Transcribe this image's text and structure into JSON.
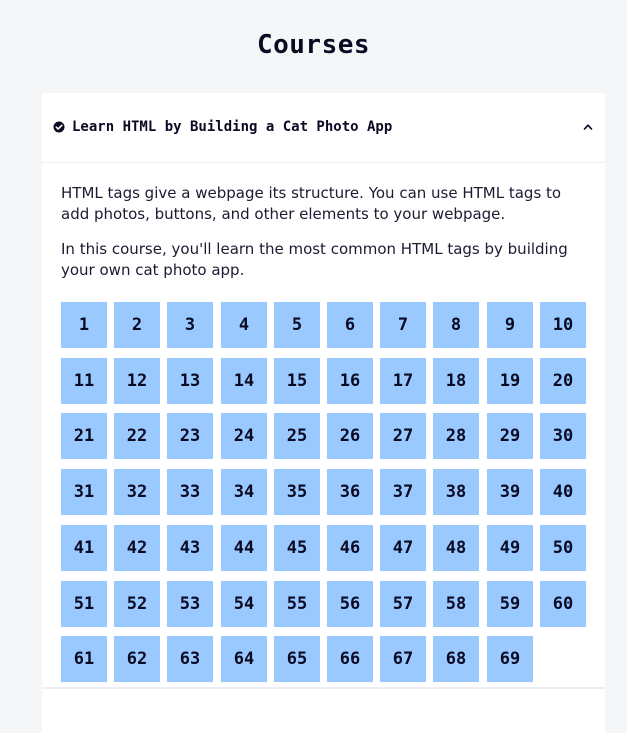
{
  "page_title": "Courses",
  "course": {
    "title": "Learn HTML by Building a Cat Photo App",
    "status_icon": "check-circle-icon",
    "toggle_icon": "chevron-up-icon",
    "description": [
      "HTML tags give a webpage its structure. You can use HTML tags to add photos, buttons, and other elements to your webpage.",
      "In this course, you'll learn the most common HTML tags by building your own cat photo app."
    ],
    "steps": [
      "1",
      "2",
      "3",
      "4",
      "5",
      "6",
      "7",
      "8",
      "9",
      "10",
      "11",
      "12",
      "13",
      "14",
      "15",
      "16",
      "17",
      "18",
      "19",
      "20",
      "21",
      "22",
      "23",
      "24",
      "25",
      "26",
      "27",
      "28",
      "29",
      "30",
      "31",
      "32",
      "33",
      "34",
      "35",
      "36",
      "37",
      "38",
      "39",
      "40",
      "41",
      "42",
      "43",
      "44",
      "45",
      "46",
      "47",
      "48",
      "49",
      "50",
      "51",
      "52",
      "53",
      "54",
      "55",
      "56",
      "57",
      "58",
      "59",
      "60",
      "61",
      "62",
      "63",
      "64",
      "65",
      "66",
      "67",
      "68",
      "69"
    ]
  },
  "colors": {
    "step_bg": "#99c9ff",
    "text": "#0a0a23",
    "page_bg": "#f5f6f7",
    "card_bg": "#ffffff"
  }
}
